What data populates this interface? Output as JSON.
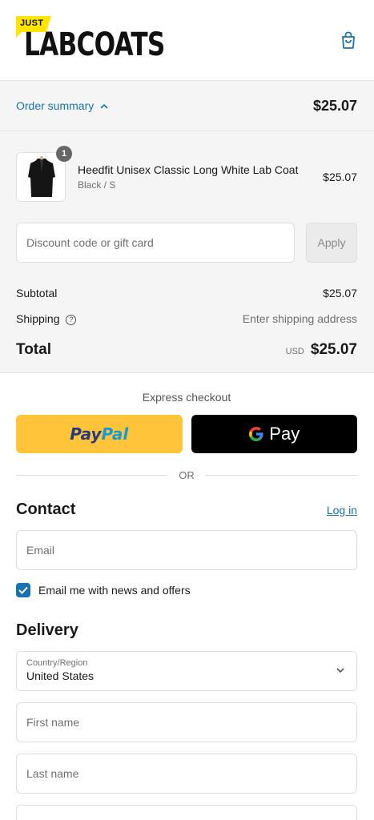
{
  "brand": {
    "logo_small": "JUST",
    "logo_main": "LABCOATS"
  },
  "summary": {
    "toggle_label": "Order summary",
    "total": "$25.07"
  },
  "line_item": {
    "name": "Heedfit Unisex Classic Long White Lab Coat",
    "variant": "Black / S",
    "price": "$25.07",
    "quantity": "1"
  },
  "discount": {
    "placeholder": "Discount code or gift card",
    "apply_label": "Apply"
  },
  "totals": {
    "subtotal_label": "Subtotal",
    "subtotal_value": "$25.07",
    "shipping_label": "Shipping",
    "shipping_value": "Enter shipping address",
    "total_label": "Total",
    "currency": "USD",
    "total_value": "$25.07"
  },
  "express": {
    "title": "Express checkout",
    "paypal_pay": "Pay",
    "paypal_pal": "Pal",
    "gpay_label": "Pay",
    "or_label": "OR"
  },
  "contact": {
    "title": "Contact",
    "login_label": "Log in",
    "email_placeholder": "Email",
    "newsletter_label": "Email me with news and offers",
    "newsletter_checked": true
  },
  "delivery": {
    "title": "Delivery",
    "country_label": "Country/Region",
    "country_value": "United States",
    "first_name_placeholder": "First name",
    "last_name_placeholder": "Last name"
  },
  "colors": {
    "accent": "#1773b0",
    "paypal_bg": "#ffc439",
    "brand_yellow": "#ffe600"
  }
}
